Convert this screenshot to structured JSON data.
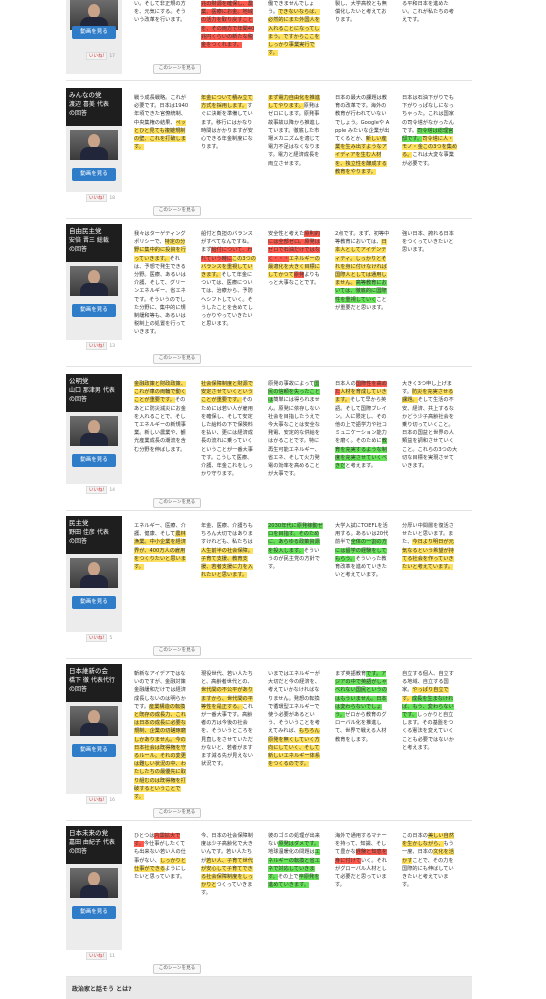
{
  "common": {
    "video_label": "動画を見る",
    "scene_label": "このシーンを見る",
    "like_prefix": "いいね!"
  },
  "top": {
    "cells": [
      [
        {
          "t": "い。そして非正規の方を、元気にする。そういう改革を行います。"
        }
      ],
      [
        {
          "t": "兆の財源を確保し、農業、医療にお金。地域の活力を取り戻すことを、その両方で年間40兆円くらいの新たな税金をつくれます。",
          "h": "hr"
        }
      ],
      [
        {
          "t": "働できませんでしょう。"
        },
        {
          "t": "できないならば、必然的にまた外国人を",
          "h": "hy"
        },
        {
          "t": "入れることになってしまう。ですからここをしっかり",
          "h": "hy"
        },
        {
          "t": "事業実行です。",
          "h": "hy"
        }
      ],
      [
        {
          "t": "製し、大学高校とも無償化したいと考えております。"
        }
      ],
      [
        {
          "t": "る平和日本を進めたい。これが私たちの考えです。"
        }
      ]
    ],
    "likes": "17"
  },
  "rows": [
    {
      "party": "みんなの党",
      "leader": "渡辺 喜美 代表",
      "role": "の回答",
      "likes": "18",
      "cells": [
        [
          {
            "t": "戦う成長戦略。これが必要です。日本は1940年頃できた官僚統制、中央集権の結果、"
          },
          {
            "t": "ペッとひと見ても複雑規制の壁、これを打破します。",
            "h": "hy"
          }
        ],
        [
          {
            "t": "年金について積み立て方式を採用します。",
            "h": "hy"
          },
          {
            "t": "すぐに決断を準備しています。移行にはかなり時間はかかりますが安心できる年金制度になります。"
          }
        ],
        [
          {
            "t": "まず電力自由化を推進してやります。",
            "h": "hy"
          },
          {
            "t": "原発はゼロにします。原発事故事故以降から推進しています。徹底した市場メカニズムを適じて電力不足はなくなります。電力と経済成長を両立させます。"
          }
        ],
        [
          {
            "t": "日本の最大の課題は教育の改革です。海外の教育が行われていないでしょう。Googleや Apple みたいな企業が出てくるとか、"
          },
          {
            "t": "新しい産業を生み出すようなアイディアを生む人材を、独立性を醸成する教育をやります。",
            "h": "hy"
          }
        ],
        [
          {
            "t": "日本は石油下がりでも下がりっぱなしになっちゃった。これは国家の司令塔がなかったんです。"
          },
          {
            "t": "司令塔は総理官邸です。",
            "h": "hg"
          },
          {
            "t": "司令塔に人・モノ・金この3つを集める。",
            "h": "hy"
          },
          {
            "t": "これは大変な事業が必要です。"
          }
        ]
      ]
    },
    {
      "party": "自由民主党",
      "leader": "安倍 晋三 総裁",
      "role": "の回答",
      "likes": "13",
      "cells": [
        [
          {
            "t": "我々はターゲティングポリシーで、"
          },
          {
            "t": "特定の分野に集中的に投資を行っていきます。",
            "h": "hy"
          },
          {
            "t": "それは、予想で発生できる分野。医療、あるいは介護、そして、グリーンエネルギー、省エネです。そういうのでした分野に、集中的に規制緩和等も、あるいは税制上の処置を行っていきます。"
          }
        ],
        [
          {
            "t": "船付と負担のバランスがすべてなんですね。まず"
          },
          {
            "t": "給付について、われていう時に",
            "h": "hr"
          },
          {
            "t": "この3つのバランスを重視していきます。",
            "h": "hy"
          },
          {
            "t": "そして年金については、医療については、治療から、予防へシフトしていく。そうしたことを含めてしっかりやっていきたいと思います。"
          }
        ],
        [
          {
            "t": "安全性と考えた"
          },
          {
            "t": "原則的には全部ゼロ。原発はゼロで石油だけではなく・・・",
            "h": "hr"
          },
          {
            "t": "エネルギーの最適化を大きく目標にしてかつて",
            "h": "hy"
          },
          {
            "t": "原発",
            "h": "hr"
          },
          {
            "t": "よりもっと大事なことです。"
          }
        ],
        [
          {
            "t": "2点です。まず、初等中等教育においては、"
          },
          {
            "t": "日本人としてアイデンティティ。しっかりとそれを身に付けなければ国際人としては通用しません。",
            "h": "hy"
          },
          {
            "t": "高等教育においては、徹底的に国際性を重視していく",
            "h": "hg"
          },
          {
            "t": "ことが重要だと思います。"
          }
        ],
        [
          {
            "t": "強い日本、誇れる日本をつくっていきたいと思います。"
          }
        ]
      ]
    },
    {
      "party": "公明党",
      "leader": "山口 那津男 代表",
      "role": "の回答",
      "likes": "14",
      "cells": [
        [
          {
            "t": "金融政策と財政政策、これが車の両輪で動くことが重要です。",
            "h": "hy"
          },
          {
            "t": "そのあとに防災減災にお金を入れることで、そしてエネルギーの新規事業。新しい農業や、観光産業成長の潮流を含む分野を伸ばします。"
          }
        ],
        [
          {
            "t": "社会保障制度と財源で安定させていくということが重要です。",
            "h": "hy"
          },
          {
            "t": "そのためには若い人が雇用を確保し、そして安定した給料の下で保険料を払い、更には経済成長の流れに乗っていくということが一番大事です。こうして医療、介護、年金これをしっかり守ります。"
          }
        ],
        [
          {
            "t": "原発の事故によって"
          },
          {
            "t": "国民の信頼を失ったことは",
            "h": "hg"
          },
          {
            "t": "簡単には得られません。原発に依存しない社会を目指したうえで今大事なことは安全な発電、安定的な供給をはかることです。特に再生可能エネルギー、省エネ、そして火力発電の効率を高めることが大事です。"
          }
        ],
        [
          {
            "t": "日本人の"
          },
          {
            "t": "国際性を高めた",
            "h": "hr"
          },
          {
            "t": "人材を育成していきます。",
            "h": "hy"
          },
          {
            "t": "そして早から英語。そして国際ブレイン。人に限定し、その他の上で語学力や社コミュニケーション能力を磨く。そのために"
          },
          {
            "t": "教育を充実するような制度を充実させていくべきだ",
            "h": "hg"
          },
          {
            "t": "と考えます。"
          }
        ],
        [
          {
            "t": "大きく3つ申し上げます。"
          },
          {
            "t": "防災を充実させる課題。",
            "h": "hy"
          },
          {
            "t": "そして生活の不安、経済、共上するなかどう少子高齢社会を乗り切っていくこと。日本の国益と世界の人類益を調和させていくこと。これらの3つの大切な目標を実現させていきます。"
          }
        ]
      ]
    },
    {
      "party": "民主党",
      "leader": "野田 佳彦 代表",
      "role": "の回答",
      "likes": "5",
      "cells": [
        [
          {
            "t": "エネルギー、医療、介護、健康、そして"
          },
          {
            "t": "農林漁業。中小企業を経済界が、400万人の雇用をつくりたいと思います。",
            "h": "hy"
          }
        ],
        [
          {
            "t": "年金、医療、介護ちもちろん大切ではありますけれども、私たちは"
          },
          {
            "t": "人生前半の社会保障。子育て支援、教育支援、若者支援に力を入れたいと思います。",
            "h": "hy"
          }
        ],
        [
          {
            "t": "2030年代に原発稼動ゼロを目指す。そのために、あらゆる政策資源を投入します。",
            "h": "hg"
          },
          {
            "t": "そういうのが民主党の方針です。"
          }
        ],
        [
          {
            "t": "大学入試にTOEFLを活用する。あるいは20代前半で"
          },
          {
            "t": "全体の一割の方には留学の経験をしてもらう。",
            "h": "hg"
          },
          {
            "t": "そういった教育改革を進めていきたいと考えています。"
          }
        ],
        [
          {
            "t": "分厚い中間層を復活させたいと思います。また、"
          },
          {
            "t": "今日より明日が元気なるという希望が持てる社会を作っていきたいと考えています。",
            "h": "hy"
          }
        ]
      ]
    },
    {
      "party": "日本維新の会",
      "leader": "橋下 徹 代表代行",
      "role": "の回答",
      "likes": "16",
      "cells": [
        [
          {
            "t": "斬新なアイデアではないのですが、金融対策金融緩和だけでは経済成長しないのは明らかです。"
          },
          {
            "t": "産業構造の転換と既存の成長力、これは日本の成長に必要な規制、企業の切磋琢磨しかありません。今の日本社会は既得権を守るルール。それの変更は難しい状況の中、わたしたちの最優先に取り組むのは既得権を打破するということです。",
            "h": "hy"
          }
        ],
        [
          {
            "t": "現役世代、若い人たちと、高齢者世代との、"
          },
          {
            "t": "世代間の不公平がありますから、世代間の平等性を是正する。",
            "h": "hy"
          },
          {
            "t": "これが一番大事です。高齢者の方は今後の社会を、そういうところを見直しをさせていただかないと、若者がますます減る先が見えない状況です。"
          }
        ],
        [
          {
            "t": "いまではエネルギーが大切だと今の経済を、考えていかなければなりません。発想の転換で循環型エネルギーで使う必要があるという、そういうことを考えてみれば、"
          },
          {
            "t": "もちろん原発を無くしていく方向にしていく、そして新しいエネルギー体系をつくるのです。",
            "h": "hy"
          }
        ],
        [
          {
            "t": "まず英語教育"
          },
          {
            "t": "です。アジアの中で英語がしゃべれない国民というのはもういません。日本は変わらないでしょう。",
            "h": "hg"
          },
          {
            "t": "ゼロから教育のグローバル化を推進して、世界で戦える人材教育をします。"
          }
        ],
        [
          {
            "t": "自立する個人、自立する地域、自立する国家。"
          },
          {
            "t": "やっぱり自立です。",
            "h": "hy"
          },
          {
            "t": "成長を生まなければ、もう、変わらないです。",
            "h": "hg"
          },
          {
            "t": "しっかりと自立します。その基盤をつくる憲法を変えていくことも必要ではないかと考えます。"
          }
        ]
      ]
    },
    {
      "party": "日本未来の党",
      "leader": "嘉田 由紀子 代表",
      "role": "の回答",
      "likes": "11",
      "cells": [
        [
          {
            "t": "ひとつは"
          },
          {
            "t": "内需拡大です。",
            "h": "hr"
          },
          {
            "t": "今仕事がしたくても出来ない若い人の仕事がない、"
          },
          {
            "t": "しっかりと仕事ができる",
            "h": "hy"
          },
          {
            "t": "ようにしたいと思っています。"
          }
        ],
        [
          {
            "t": "今、日本の社会保障制度は少子高齢化で大きいんです。若い人たちが"
          },
          {
            "t": "若い人、子育て世代が安心して子育てできる社会保障制度をしっかりと",
            "h": "hy"
          },
          {
            "t": "つくっていきます。"
          }
        ],
        [
          {
            "t": "彼のゴミの処理が出来ない"
          },
          {
            "t": "原発はダメです。",
            "h": "hg"
          },
          {
            "t": "地球温暖化の問題は"
          },
          {
            "t": "エネルギーの転換と省エネで対応していきます。",
            "h": "hg"
          },
          {
            "t": "その上で"
          },
          {
            "t": "卒原発を進めていきます。",
            "h": "hg"
          }
        ],
        [
          {
            "t": "海外で通用するマナーを持って、知識、そして豊かな"
          },
          {
            "t": "経験と知恵を身に付けて",
            "h": "hr"
          },
          {
            "t": "いく。それがグローバル人材として必要だと思っています。"
          }
        ],
        [
          {
            "t": "この日本の"
          },
          {
            "t": "美しい自然を生かしながら、",
            "h": "hy"
          },
          {
            "t": "もう一度、日本の"
          },
          {
            "t": "文化を活かす",
            "h": "hy"
          },
          {
            "t": "ことで、その力を国際的にも伸ばしていきたいと考えています。"
          }
        ]
      ]
    }
  ],
  "footer": {
    "title": "政治家と話そう とは?"
  }
}
